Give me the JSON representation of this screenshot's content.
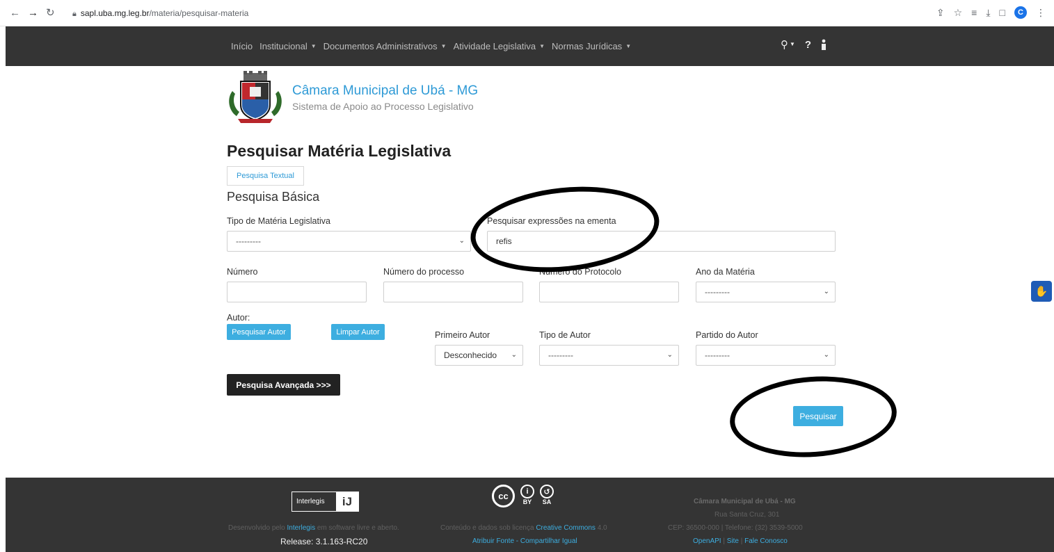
{
  "browser": {
    "url_host": "sapl.uba.mg.leg.br",
    "url_path": "/materia/pesquisar-materia",
    "profile_initial": "C"
  },
  "navbar": {
    "items": [
      "Início",
      "Institucional",
      "Documentos Administrativos",
      "Atividade Legislativa",
      "Normas Jurídicas"
    ],
    "help": "?"
  },
  "header": {
    "title": "Câmara Municipal de Ubá - MG",
    "subtitle": "Sistema de Apoio ao Processo Legislativo"
  },
  "page": {
    "title": "Pesquisar Matéria Legislativa",
    "textual_button": "Pesquisa Textual",
    "section": "Pesquisa Básica"
  },
  "form": {
    "tipo_label": "Tipo de Matéria Legislativa",
    "tipo_value": "---------",
    "ementa_label": "Pesquisar expressões na ementa",
    "ementa_value": "refis",
    "numero_label": "Número",
    "processo_label": "Número do processo",
    "protocolo_label": "Número do Protocolo",
    "ano_label": "Ano da Matéria",
    "ano_value": "---------",
    "autor_label": "Autor:",
    "pesquisar_autor": "Pesquisar Autor",
    "limpar_autor": "Limpar Autor",
    "primeiro_autor_label": "Primeiro Autor",
    "primeiro_autor_value": "Desconhecido",
    "tipo_autor_label": "Tipo de Autor",
    "tipo_autor_value": "---------",
    "partido_label": "Partido do Autor",
    "partido_value": "---------",
    "avancada_button": "Pesquisa Avançada >>>",
    "submit_button": "Pesquisar"
  },
  "footer": {
    "interlegis_logo_text": "Interlegis",
    "dev_prefix": "Desenvolvido pelo ",
    "dev_link": "Interlegis",
    "dev_suffix": " em software livre e aberto.",
    "release": "Release: 3.1.163-RC20",
    "cc_by": "BY",
    "cc_sa": "SA",
    "license_prefix": "Conteúdo e dados sob licença ",
    "license_link": "Creative Commons",
    "license_version": " 4.0",
    "license_terms": "Atribuir Fonte - Compartilhar Igual",
    "org_name": "Câmara Municipal de Ubá - MG",
    "address": "Rua Santa Cruz, 301",
    "contact": "CEP: 36500-000 | Telefone: (32) 3539-5000",
    "link_openapi": "OpenAPI",
    "link_site": "Site",
    "link_fale": "Fale Conosco"
  }
}
